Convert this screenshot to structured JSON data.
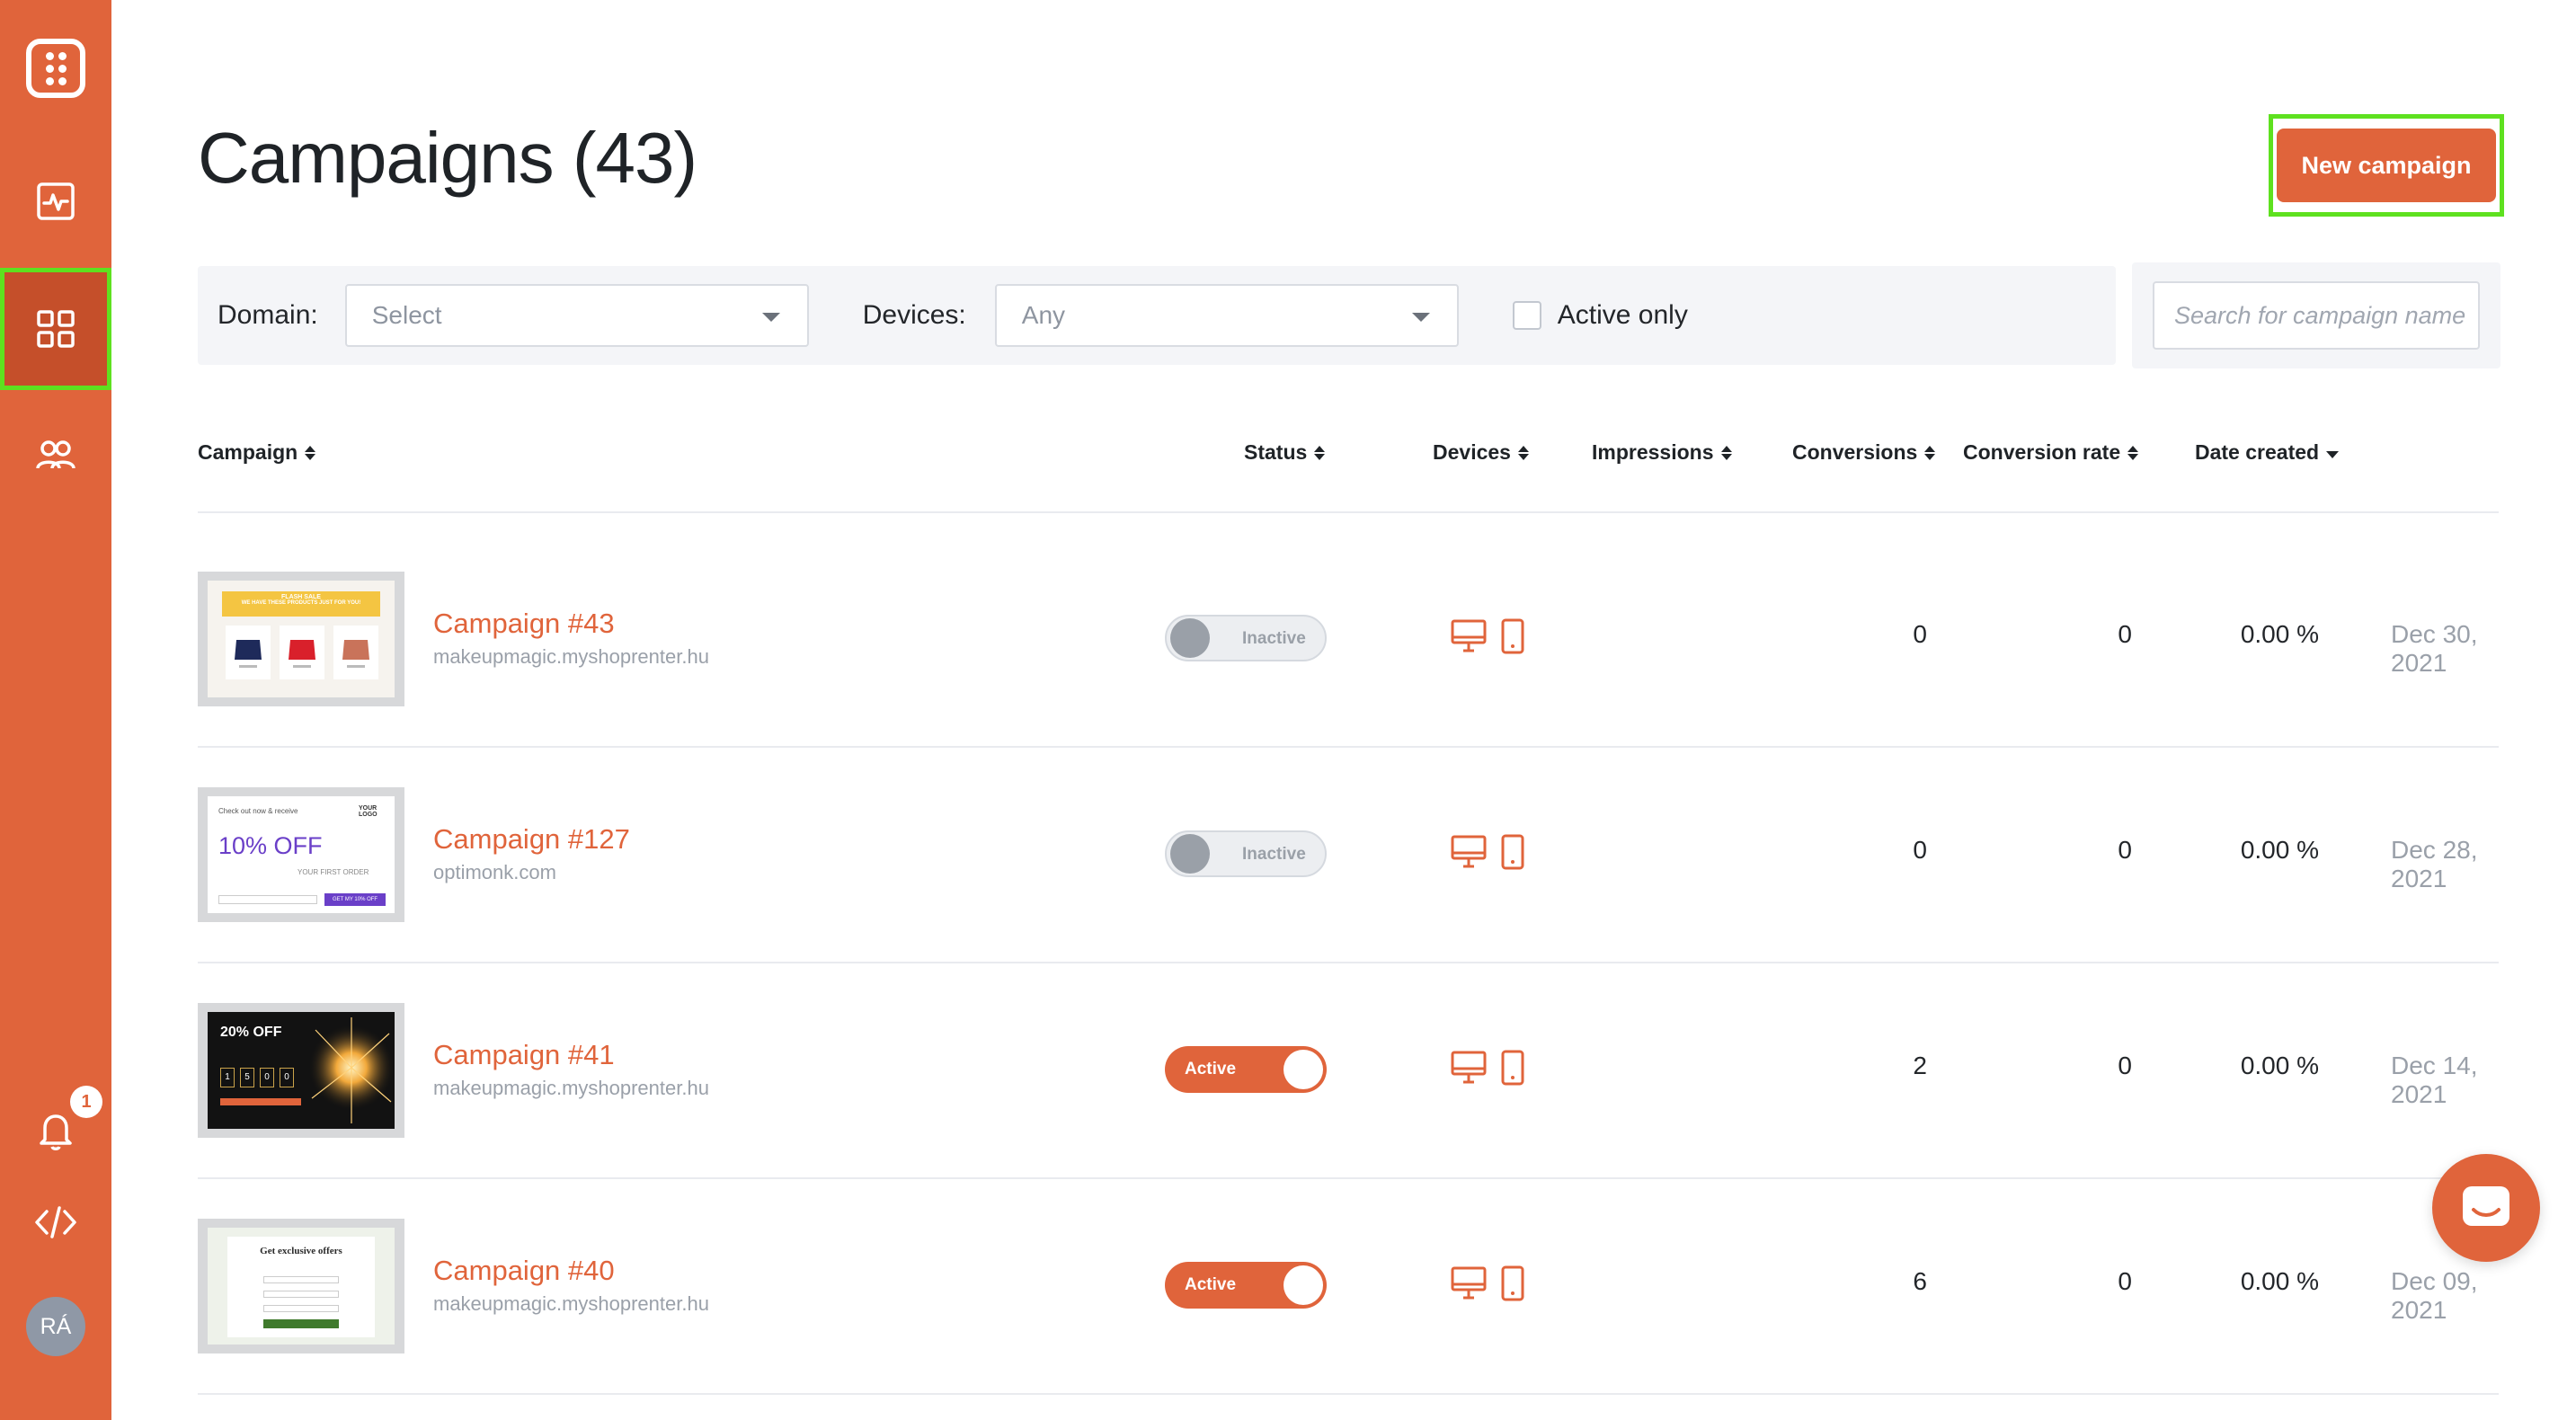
{
  "sidebar": {
    "items": [
      {
        "name": "logo",
        "icon": "app-logo-icon"
      },
      {
        "name": "analytics",
        "icon": "analytics-icon"
      },
      {
        "name": "campaigns",
        "icon": "grid-icon"
      },
      {
        "name": "audience",
        "icon": "users-icon"
      },
      {
        "name": "notifications",
        "icon": "bell-icon"
      },
      {
        "name": "code",
        "icon": "code-icon"
      }
    ],
    "notification_count": "1",
    "avatar_initials": "RÁ"
  },
  "header": {
    "title": "Campaigns (43)",
    "new_campaign_label": "New campaign"
  },
  "filters": {
    "domain_label": "Domain:",
    "domain_value": "Select",
    "devices_label": "Devices:",
    "devices_value": "Any",
    "active_only_label": "Active only",
    "search_placeholder": "Search for campaign name"
  },
  "table": {
    "columns": {
      "campaign": "Campaign",
      "status": "Status",
      "devices": "Devices",
      "impressions": "Impressions",
      "conversions": "Conversions",
      "conversion_rate": "Conversion rate",
      "date_created": "Date created"
    },
    "rows": [
      {
        "name": "Campaign #43",
        "domain": "makeupmagic.myshoprenter.hu",
        "status": "Inactive",
        "impressions": "0",
        "conversions": "0",
        "rate": "0.00 %",
        "date": "Dec 30, 2021",
        "thumb": {
          "banner": "FLASH SALE",
          "headline": "WE HAVE THESE PRODUCTS JUST FOR YOU!"
        }
      },
      {
        "name": "Campaign #127",
        "domain": "optimonk.com",
        "status": "Inactive",
        "impressions": "0",
        "conversions": "0",
        "rate": "0.00 %",
        "date": "Dec 28, 2021",
        "thumb": {
          "intro": "Check out now & receive",
          "offer": "10% OFF",
          "sub": "YOUR FIRST ORDER",
          "cta": "GET MY 10% OFF",
          "logo": "YOUR LOGO"
        }
      },
      {
        "name": "Campaign #41",
        "domain": "makeupmagic.myshoprenter.hu",
        "status": "Active",
        "impressions": "2",
        "conversions": "0",
        "rate": "0.00 %",
        "date": "Dec 14, 2021",
        "thumb": {
          "offer": "20% OFF",
          "digits": [
            "1",
            "5",
            "0",
            "0"
          ]
        }
      },
      {
        "name": "Campaign #40",
        "domain": "makeupmagic.myshoprenter.hu",
        "status": "Active",
        "impressions": "6",
        "conversions": "0",
        "rate": "0.00 %",
        "date": "Dec 09, 2021",
        "thumb": {
          "headline": "Get exclusive offers"
        }
      }
    ]
  },
  "colors": {
    "brand": "#e0643b",
    "highlight": "#5ee11f"
  }
}
